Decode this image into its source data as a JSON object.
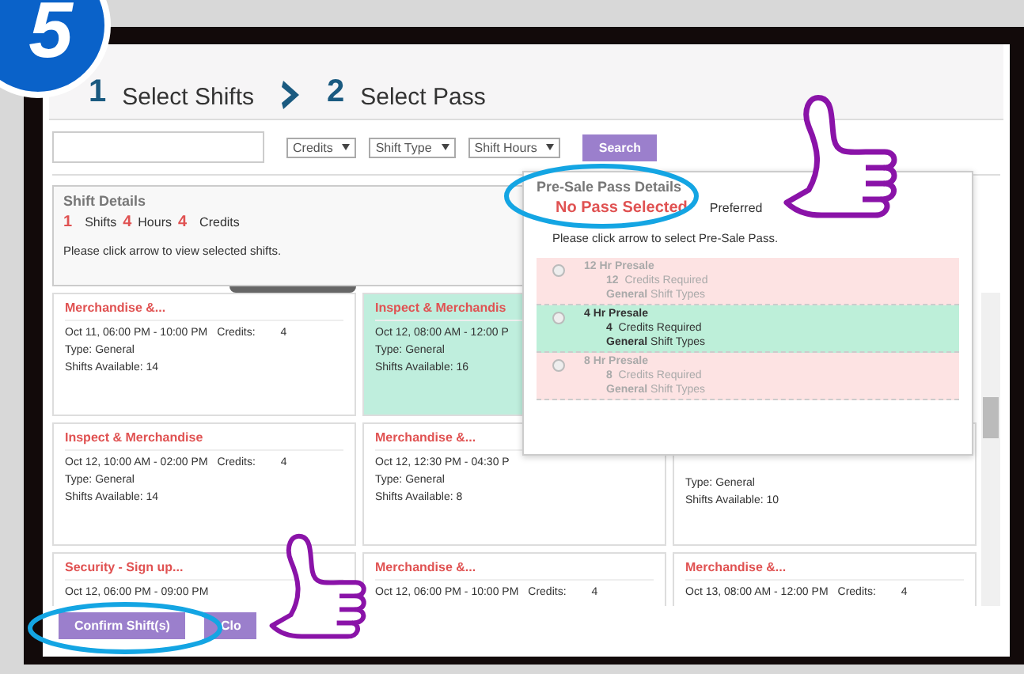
{
  "step_badge": "5",
  "steps": [
    {
      "number": "1",
      "label": "Select Shifts"
    },
    {
      "number": "2",
      "label": "Select Pass"
    }
  ],
  "filters": {
    "dropdowns": [
      "Credits",
      "Shift Type",
      "Shift Hours"
    ],
    "search_button": "Search"
  },
  "shift_details": {
    "title": "Shift Details",
    "shifts_count": "1",
    "shifts_label": "Shifts",
    "hours_count": "4",
    "hours_label": "Hours",
    "credits_count": "4",
    "credits_label": "Credits",
    "hint": "Please click arrow to view selected shifts."
  },
  "pass_details": {
    "title": "Pre-Sale Pass Details",
    "status": "No Pass Selected",
    "preferred": "Preferred",
    "hint": "Please click arrow to select Pre-Sale Pass.",
    "passes": [
      {
        "name": "12 Hr Presale",
        "credits": "12",
        "credits_label": "Credits Required",
        "type": "General",
        "type_label": "Shift Types",
        "eligible": false,
        "selected": false
      },
      {
        "name": "4 Hr Presale",
        "credits": "4",
        "credits_label": "Credits Required",
        "type": "General",
        "type_label": "Shift Types",
        "eligible": true,
        "selected": false
      },
      {
        "name": "8 Hr Presale",
        "credits": "8",
        "credits_label": "Credits Required",
        "type": "General",
        "type_label": "Shift Types",
        "eligible": false,
        "selected": false
      }
    ]
  },
  "shift_rows": [
    [
      {
        "title": "Merchandise &...",
        "date": "Oct 11, 06:00 PM - 10:00 PM",
        "credits_label": "Credits:",
        "credits": "4",
        "type": "Type: General",
        "available": "Shifts Available: 14",
        "selected": false
      },
      {
        "title": "Inspect & Merchandis",
        "date": "Oct 12, 08:00 AM - 12:00 P",
        "type": "Type: General",
        "available": "Shifts Available: 16",
        "selected": true
      }
    ],
    [
      {
        "title": "Inspect & Merchandise",
        "date": "Oct 12, 10:00 AM - 02:00 PM",
        "credits_label": "Credits:",
        "credits": "4",
        "type": "Type: General",
        "available": "Shifts Available: 14",
        "selected": false
      },
      {
        "title": "Merchandise &...",
        "date": "Oct 12, 12:30 PM - 04:30 P",
        "type": "Type: General",
        "available": "Shifts Available: 8",
        "selected": false
      },
      {
        "type": "Type: General",
        "available": "Shifts Available: 10",
        "selected": false
      }
    ],
    [
      {
        "title": "Security - Sign up...",
        "date": "Oct 12, 06:00 PM - 09:00 PM",
        "selected": false
      },
      {
        "title": "Merchandise &...",
        "date": "Oct 12, 06:00 PM - 10:00 PM",
        "credits_label": "Credits:",
        "credits": "4",
        "selected": false
      },
      {
        "title": "Merchandise &...",
        "date": "Oct 13, 08:00 AM - 12:00 PM",
        "credits_label": "Credits:",
        "credits": "4",
        "selected": false
      }
    ]
  ],
  "buttons": [
    "Confirm Shift(s)",
    "Clo"
  ]
}
